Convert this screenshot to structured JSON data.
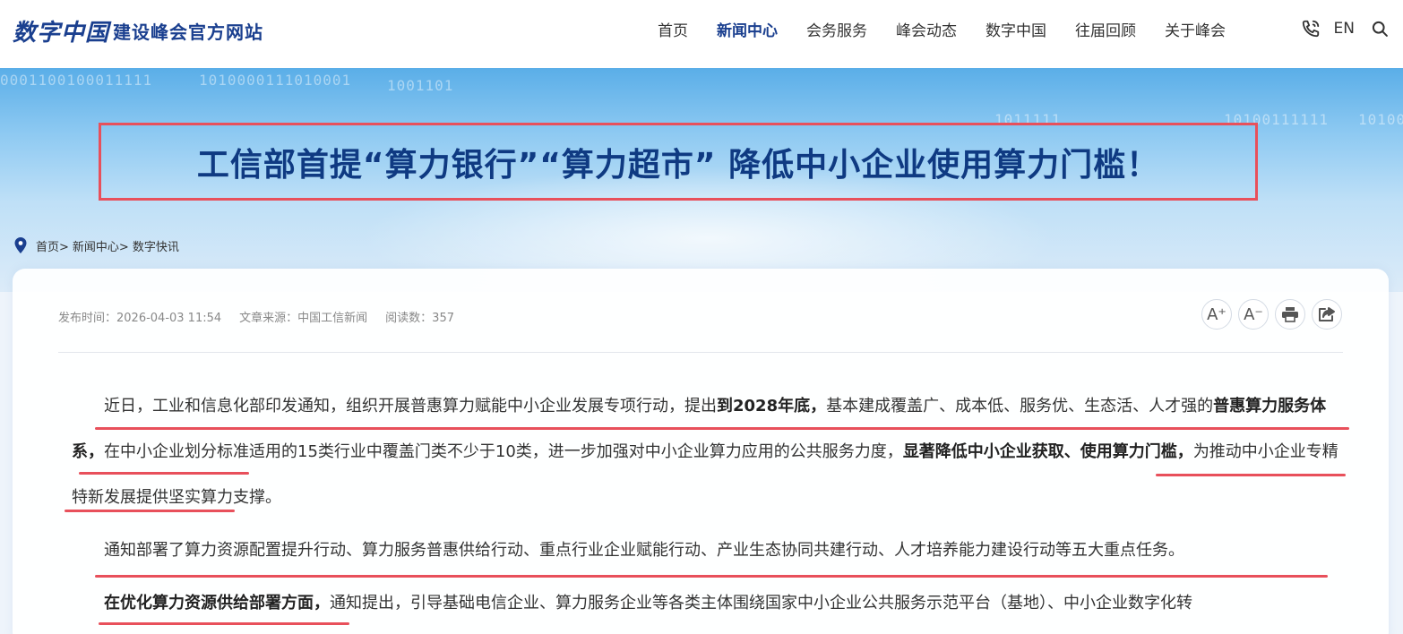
{
  "header": {
    "logo_script": "数字中国",
    "logo_text": "建设峰会官方网站",
    "nav": [
      "首页",
      "新闻中心",
      "会务服务",
      "峰会动态",
      "数字中国",
      "往届回顾",
      "关于峰会"
    ],
    "active_nav": "新闻中心",
    "lang": "EN",
    "icons": [
      "phone-icon",
      "search-icon"
    ]
  },
  "banner": {
    "binary": [
      "0001100100011111",
      "1010000111010001",
      "1001101",
      "1011111",
      "10100111111",
      "10100"
    ],
    "title": "工信部首提“算力银行”“算力超市” 降低中小企业使用算力门槛！"
  },
  "breadcrumb": {
    "items": [
      "首页>",
      "新闻中心>",
      "数字快讯"
    ]
  },
  "article": {
    "meta": {
      "publish": "发布时间：2026-04-03 11:54",
      "source": "文章来源：中国工信新闻",
      "reads": "阅读数：357"
    },
    "tools": [
      "A⁺",
      "A⁻"
    ],
    "p1": {
      "t1": "近日，工业和信息化部印发通知，组织开展普惠算力赋能中小企业发展专项行动，提出",
      "b1": "到2028年底，",
      "t2": "基本建成覆盖广、成本低、服务优、生态活、人才强的",
      "b2": "普惠算力服务体系，",
      "t3": "在中小企业划分标准适用的15类行业中覆盖门类不少于10类，进一步加强对中小企业算力应用的公共服务力度，",
      "b3": "显著降低中小企业获取、使用算力门槛，",
      "t4": "为推动中小企业专精特新发展提供坚实算力支撑。"
    },
    "p2": "通知部署了算力资源配置提升行动、算力服务普惠供给行动、重点行业企业赋能行动、产业生态协同共建行动、人才培养能力建设行动等五大重点任务。",
    "p3": {
      "b1": "在优化算力资源供给部署方面，",
      "t1": "通知提出，引导基础电信企业、算力服务企业等各类主体围绕国家中小企业公共服务示范平台（基地）、中小企业数字化转"
    }
  },
  "colors": {
    "brand": "#1a3f8f",
    "title": "#0f3a82",
    "highlight": "#e8505b"
  }
}
